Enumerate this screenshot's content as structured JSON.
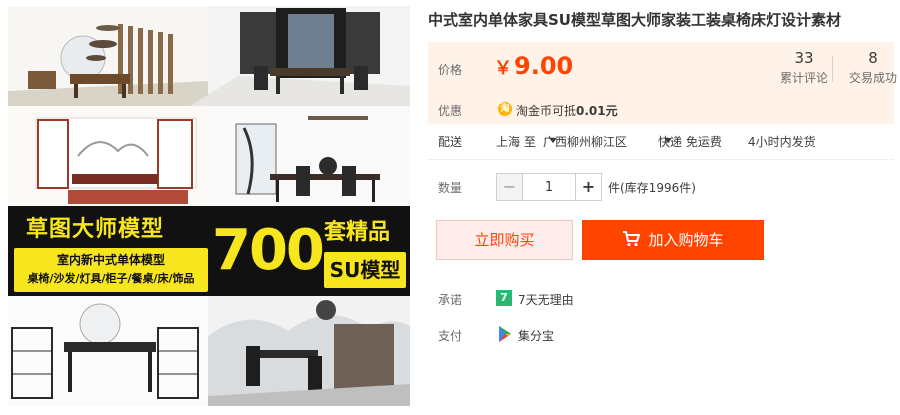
{
  "product": {
    "title": "中式室内单体家具SU模型草图大师家装工装桌椅床灯设计素材"
  },
  "gallery": {
    "banner": {
      "headline": "草图大师模型",
      "subtitle_1": "室内新中式单体模型",
      "subtitle_2": "桌椅/沙发/灯具/柜子/餐桌/床/饰品",
      "number": "700",
      "suffix": "套精品",
      "tag": "SU模型"
    }
  },
  "price": {
    "label": "价格",
    "currency": "￥",
    "amount": "9.00",
    "color": "#ff4400"
  },
  "stats": [
    {
      "number": "33",
      "label": "累计评论"
    },
    {
      "number": "8",
      "label": "交易成功"
    }
  ],
  "promo": {
    "label": "优惠",
    "coin_icon": "淘",
    "text": "淘金币可抵",
    "value": "0.01元"
  },
  "shipping": {
    "label": "配送",
    "from": "上海 至",
    "to": "广西柳州柳江区",
    "method": "快递 免运费",
    "dispatch": "4小时内发货"
  },
  "quantity": {
    "label": "数量",
    "value": "1",
    "minus": "−",
    "plus": "+",
    "stock_text": "件(库存1996件)"
  },
  "actions": {
    "buy_now": "立即购买",
    "add_to_cart": "加入购物车",
    "accent": "#ff4400"
  },
  "guarantee": {
    "label": "承诺",
    "badge": "7",
    "text": "7天无理由"
  },
  "payment": {
    "label": "支付",
    "icon": "jifenbao-icon",
    "text": "集分宝"
  }
}
